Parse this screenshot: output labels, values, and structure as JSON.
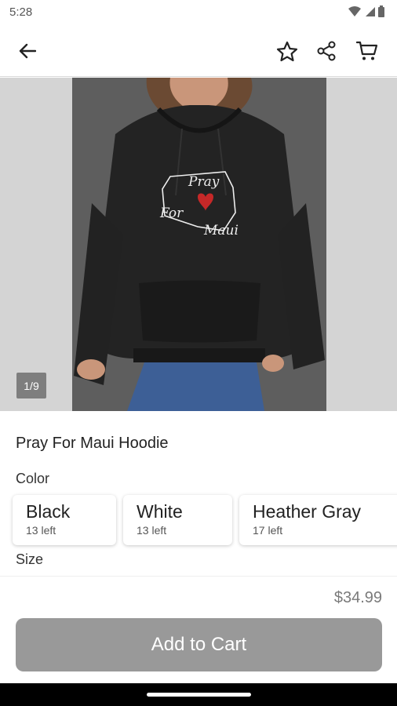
{
  "status": {
    "time": "5:28",
    "icons": [
      "wifi-icon",
      "signal-icon",
      "battery-icon"
    ]
  },
  "toolbar": {
    "back_icon": "arrow-left-icon",
    "actions": [
      "star-icon",
      "share-icon",
      "cart-icon"
    ]
  },
  "gallery": {
    "counter": "1/9",
    "print_text": [
      "Pray",
      "For",
      "Maui"
    ]
  },
  "product": {
    "title": "Pray For Maui Hoodie",
    "color_label": "Color",
    "size_label": "Size",
    "variants": [
      {
        "name": "Black",
        "stock": "13 left"
      },
      {
        "name": "White",
        "stock": "13 left"
      },
      {
        "name": "Heather Gray",
        "stock": "17 left"
      }
    ]
  },
  "footer": {
    "price": "$34.99",
    "add_to_cart": "Add to Cart"
  },
  "colors": {
    "button_disabled": "#999999",
    "price": "#7a7a7a",
    "heart": "#c62828"
  }
}
